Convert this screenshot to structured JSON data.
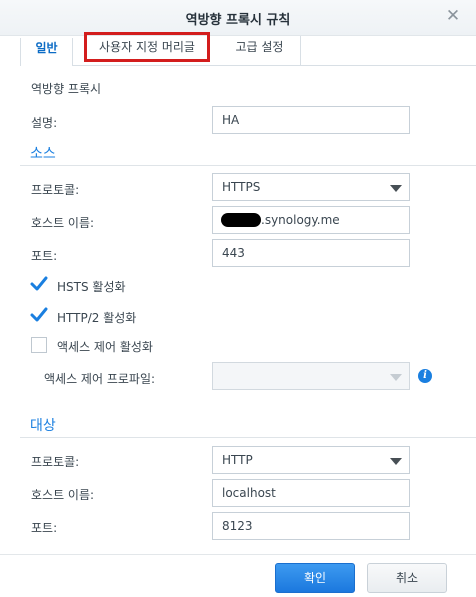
{
  "dialog": {
    "title": "역방향 프록시 규칙",
    "close_symbol": "✕"
  },
  "tabs": [
    {
      "label": "일반",
      "active": true
    },
    {
      "label": "사용자 지정 머리글",
      "active": false,
      "highlighted": true
    },
    {
      "label": "고급 설정",
      "active": false
    }
  ],
  "general": {
    "subtitle": "역방향 프록시",
    "description_label": "설명:",
    "description_value": "HA"
  },
  "source": {
    "section_title": "소스",
    "protocol_label": "프로토콜:",
    "protocol_value": "HTTPS",
    "hostname_label": "호스트 이름:",
    "hostname_value_suffix": ".synology.me",
    "port_label": "포트:",
    "port_value": "443",
    "hsts_label": "HSTS 활성화",
    "hsts_checked": true,
    "http2_label": "HTTP/2 활성화",
    "http2_checked": true,
    "access_control_label": "액세스 제어 활성화",
    "access_control_checked": false,
    "access_profile_label": "액세스 제어 프로파일:",
    "access_profile_value": ""
  },
  "destination": {
    "section_title": "대상",
    "protocol_label": "프로토콜:",
    "protocol_value": "HTTP",
    "hostname_label": "호스트 이름:",
    "hostname_value": "localhost",
    "port_label": "포트:",
    "port_value": "8123"
  },
  "buttons": {
    "ok_label": "확인",
    "cancel_label": "취소"
  },
  "colors": {
    "accent": "#1a7fe0",
    "highlight_border": "#d31d1d",
    "ok_button": "#2a88e8"
  },
  "icons": {
    "info": "info-icon",
    "check": "check-icon",
    "dropdown": "chevron-down-icon",
    "close": "close-icon"
  }
}
